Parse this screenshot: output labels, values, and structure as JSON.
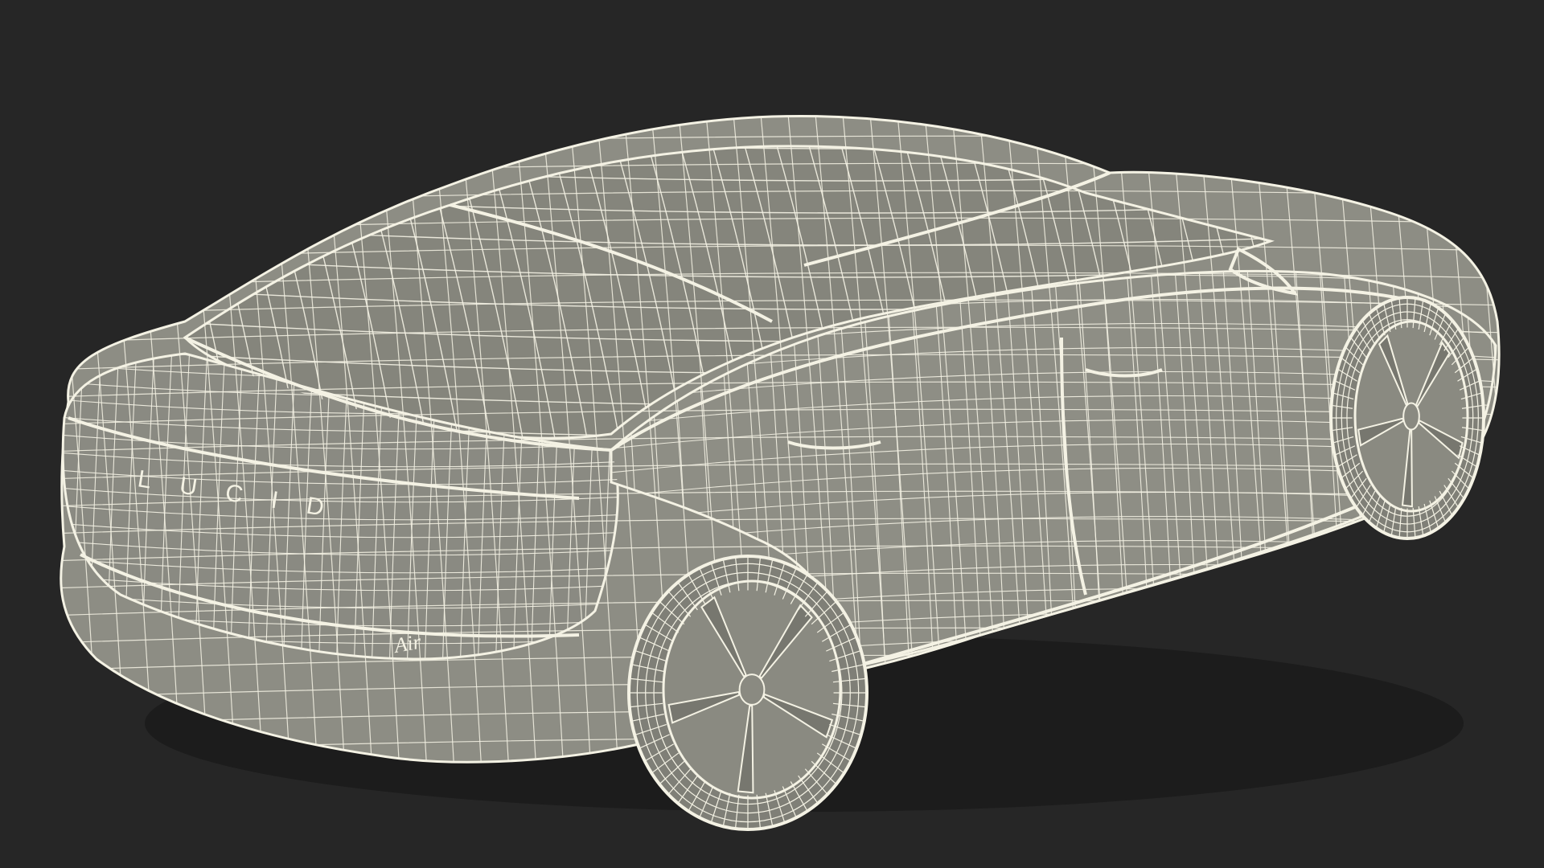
{
  "scene": {
    "background_color": "#262626",
    "surface_color": "#8c8c83",
    "wire_color": "#f4f2e4"
  },
  "badges": {
    "brand_lettering": "LUCID",
    "model_script": "Air"
  }
}
